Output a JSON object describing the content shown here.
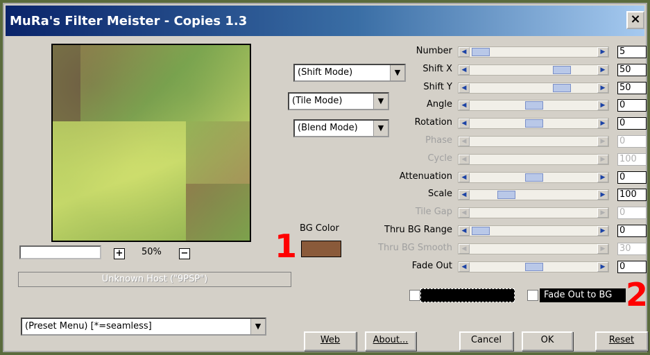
{
  "window": {
    "title": "MuRa's Filter Meister - Copies 1.3",
    "close_label": "×"
  },
  "preview": {
    "zoom_in": "+",
    "zoom_out": "−",
    "zoom_level": "50%",
    "host_status": "Unknown Host (\"9PSP\")"
  },
  "modes": {
    "shift_mode": "(Shift Mode)",
    "tile_mode": "(Tile Mode)",
    "blend_mode": "(Blend Mode)"
  },
  "params": [
    {
      "label": "Number",
      "value": "5",
      "enabled": true,
      "level": 0.02
    },
    {
      "label": "Shift X",
      "value": "50",
      "enabled": true,
      "level": 0.75
    },
    {
      "label": "Shift Y",
      "value": "50",
      "enabled": true,
      "level": 0.75
    },
    {
      "label": "Angle",
      "value": "0",
      "enabled": true,
      "level": 0.5
    },
    {
      "label": "Rotation",
      "value": "0",
      "enabled": true,
      "level": 0.5
    },
    {
      "label": "Phase",
      "value": "0",
      "enabled": false,
      "level": 0
    },
    {
      "label": "Cycle",
      "value": "100",
      "enabled": false,
      "level": 0
    },
    {
      "label": "Attenuation",
      "value": "0",
      "enabled": true,
      "level": 0.5
    },
    {
      "label": "Scale",
      "value": "100",
      "enabled": true,
      "level": 0.25
    },
    {
      "label": "Tile Gap",
      "value": "0",
      "enabled": false,
      "level": 0
    },
    {
      "label": "Thru BG Range",
      "value": "0",
      "enabled": true,
      "level": 0.02
    },
    {
      "label": "Thru BG Smooth",
      "value": "30",
      "enabled": false,
      "level": 0
    },
    {
      "label": "Fade Out",
      "value": "0",
      "enabled": true,
      "level": 0.5
    }
  ],
  "bg_color": {
    "label": "BG Color",
    "swatch_color": "#8a5a3a"
  },
  "annotations": {
    "mark1": "1",
    "mark2": "2"
  },
  "fade_out_to_bg_label": "Fade Out to BG",
  "preset_menu": "(Preset Menu) [*=seamless]",
  "buttons": {
    "web": "Web",
    "about": "About...",
    "cancel": "Cancel",
    "ok": "OK",
    "reset": "Reset"
  }
}
